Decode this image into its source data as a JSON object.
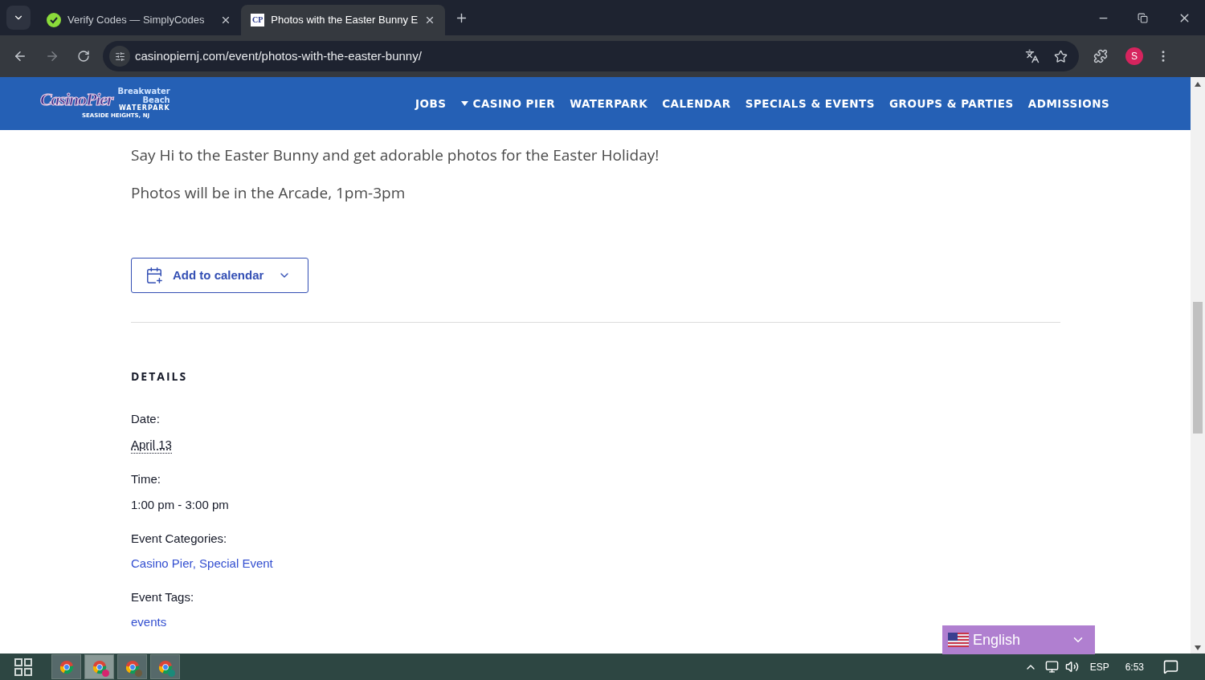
{
  "browser": {
    "tabs": [
      {
        "title": "Verify Codes — SimplyCodes",
        "kind": "simplycodes",
        "selected": false
      },
      {
        "title": "Photos with the Easter Bunny E",
        "kind": "casinopier",
        "favicon_text": "CP",
        "selected": true
      }
    ],
    "url": "casinopiernj.com/event/photos-with-the-easter-bunny/",
    "profile": "S"
  },
  "site_header": {
    "logo": {
      "casino": "CasinoPier",
      "beach_line1": "Breakwater",
      "beach_line2": "Beach",
      "waterpark": "WATERPARK",
      "location": "SEASIDE HEIGHTS, NJ"
    },
    "nav": [
      {
        "label": "JOBS",
        "dropdown": false
      },
      {
        "label": "CASINO PIER",
        "dropdown": true
      },
      {
        "label": "WATERPARK",
        "dropdown": false
      },
      {
        "label": "CALENDAR",
        "dropdown": false
      },
      {
        "label": "SPECIALS & EVENTS",
        "dropdown": false
      },
      {
        "label": "GROUPS & PARTIES",
        "dropdown": false
      },
      {
        "label": "ADMISSIONS",
        "dropdown": false
      }
    ]
  },
  "content": {
    "paragraphs": [
      "Say Hi to the Easter Bunny and get adorable photos for the Easter Holiday!",
      "Photos will be in the Arcade, 1pm-3pm"
    ],
    "add_to_calendar": "Add to calendar",
    "details": {
      "heading": "DETAILS",
      "fields": [
        {
          "label": "Date:",
          "value": "April 13",
          "kind": "abbr"
        },
        {
          "label": "Time:",
          "value": "1:00 pm - 3:00 pm",
          "kind": "text"
        },
        {
          "label": "Event Categories:",
          "value": "Casino Pier, Special Event",
          "kind": "link"
        },
        {
          "label": "Event Tags:",
          "value": "events",
          "kind": "link"
        }
      ]
    }
  },
  "language_selector": {
    "value": "English"
  },
  "taskbar": {
    "apps": [
      {
        "selected": false
      },
      {
        "selected": true,
        "color": "#d6246e"
      },
      {
        "selected": false,
        "color": "#6b5b3e"
      },
      {
        "selected": false,
        "color": "#1a8a7a"
      }
    ],
    "tray": {
      "language": "ESP",
      "time": "6:53"
    }
  }
}
